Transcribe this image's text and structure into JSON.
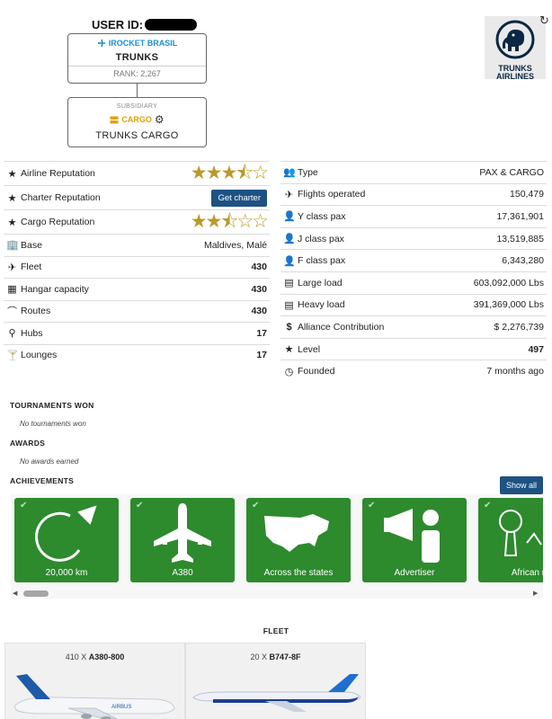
{
  "header": {
    "user_id_label": "USER ID:",
    "alliance_name": "IROCKET BRASIL",
    "airline_name": "TRUNKS",
    "rank": "RANK: 2,267",
    "subsidiary_label": "SUBSIDIARY",
    "subsidiary_type": "CARGO",
    "subsidiary_name": "TRUNKS CARGO",
    "logo_line1": "TRUNKS",
    "logo_line2": "AIRLINES"
  },
  "left_stats": [
    {
      "label": "Airline Reputation",
      "icon": "star-icon",
      "stars": 3.5
    },
    {
      "label": "Charter Reputation",
      "icon": "star-icon",
      "button": "Get charter"
    },
    {
      "label": "Cargo Reputation",
      "icon": "star-icon",
      "stars": 2.5
    },
    {
      "label": "Base",
      "icon": "building-icon",
      "value": "Maldives, Malé"
    },
    {
      "label": "Fleet",
      "icon": "plane-icon",
      "value": "430"
    },
    {
      "label": "Hangar capacity",
      "icon": "hangar-icon",
      "value": "430"
    },
    {
      "label": "Routes",
      "icon": "route-icon",
      "value": "430"
    },
    {
      "label": "Hubs",
      "icon": "pin-icon",
      "value": "17"
    },
    {
      "label": "Lounges",
      "icon": "lounge-icon",
      "value": "17"
    }
  ],
  "right_stats": [
    {
      "label": "Type",
      "icon": "people-icon",
      "value": "PAX & CARGO"
    },
    {
      "label": "Flights operated",
      "icon": "plane-icon",
      "value": "150,479"
    },
    {
      "label": "Y class pax",
      "icon": "person-icon",
      "value": "17,361,901"
    },
    {
      "label": "J class pax",
      "icon": "person-icon",
      "value": "13,519,885"
    },
    {
      "label": "F class pax",
      "icon": "person-icon",
      "value": "6,343,280"
    },
    {
      "label": "Large load",
      "icon": "cargo-icon",
      "value": "603,092,000 Lbs"
    },
    {
      "label": "Heavy load",
      "icon": "cargo-icon",
      "value": "391,369,000 Lbs"
    },
    {
      "label": "Alliance Contribution",
      "icon": "dollar-icon",
      "value": "$ 2,276,739"
    },
    {
      "label": "Level",
      "icon": "star-icon",
      "value": "497"
    },
    {
      "label": "Founded",
      "icon": "clock-icon",
      "value": "7 months ago"
    }
  ],
  "sections": {
    "tournaments_title": "TOURNAMENTS WON",
    "tournaments_note": "No tournaments won",
    "awards_title": "AWARDS",
    "awards_note": "No awards earned",
    "achievements_title": "ACHIEVEMENTS",
    "show_all": "Show all"
  },
  "achievements": [
    {
      "name": "20,000 km",
      "icon": "orbit-plane-icon"
    },
    {
      "name": "A380",
      "icon": "a380-icon"
    },
    {
      "name": "Across the states",
      "icon": "usa-map-icon"
    },
    {
      "name": "Advertiser",
      "icon": "megaphone-icon"
    },
    {
      "name": "African m",
      "icon": "baobab-icon"
    }
  ],
  "fleet": {
    "title": "FLEET",
    "items": [
      {
        "count": "410 X ",
        "model": "A380-800"
      },
      {
        "count": "20 X ",
        "model": "B747-8F"
      }
    ]
  },
  "colors": {
    "accent_blue": "#1d5283",
    "star_gold": "#b99a2b",
    "achievement_green": "#2d8a2d",
    "alliance_blue": "#1a8fd6",
    "cargo_yellow": "#e0a100"
  }
}
